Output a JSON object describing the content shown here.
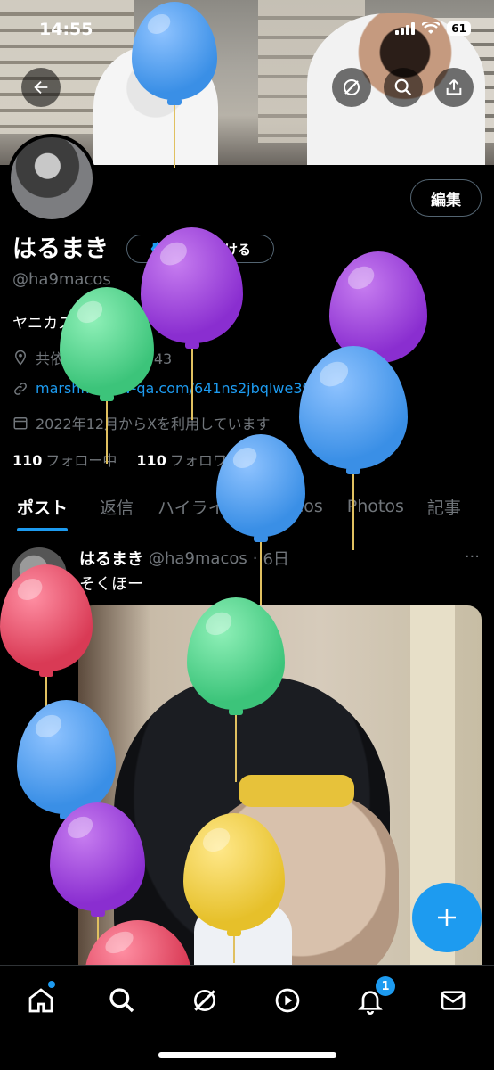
{
  "status": {
    "time": "14:55",
    "battery": "61"
  },
  "profile": {
    "name": "はるまき",
    "handle": "@ha9macos",
    "edit_label": "編集",
    "verify_label": "認証を受ける",
    "bio": "ヤニカス 趣味",
    "location": "共依存 @aipri_2043",
    "link": "marshmallow-qa.com/641ns2jbqlwe39...",
    "joined": "2022年12月からXを利用しています",
    "following_count": "110",
    "following_label": "フォロー中",
    "followers_count": "110",
    "followers_label": "フォロワー"
  },
  "tabs": [
    {
      "label": "ポスト"
    },
    {
      "label": "返信"
    },
    {
      "label": "ハイライト"
    },
    {
      "label": "Videos"
    },
    {
      "label": "Photos"
    },
    {
      "label": "記事"
    }
  ],
  "post": {
    "name": "はるまき",
    "handle": "@ha9macos",
    "time": "6日",
    "text": "そくほー",
    "more": "···"
  },
  "nav": {
    "notification_count": "1"
  },
  "colors": {
    "accent": "#1d9bf0",
    "background": "#000000",
    "muted": "#71767b"
  },
  "icons": [
    "back-arrow-icon",
    "grok-icon",
    "search-icon",
    "share-icon",
    "verified-badge-icon",
    "location-icon",
    "link-icon",
    "calendar-icon",
    "compose-plus-icon",
    "home-icon",
    "explore-icon",
    "grok-nav-icon",
    "video-icon",
    "bell-icon",
    "mail-icon"
  ]
}
